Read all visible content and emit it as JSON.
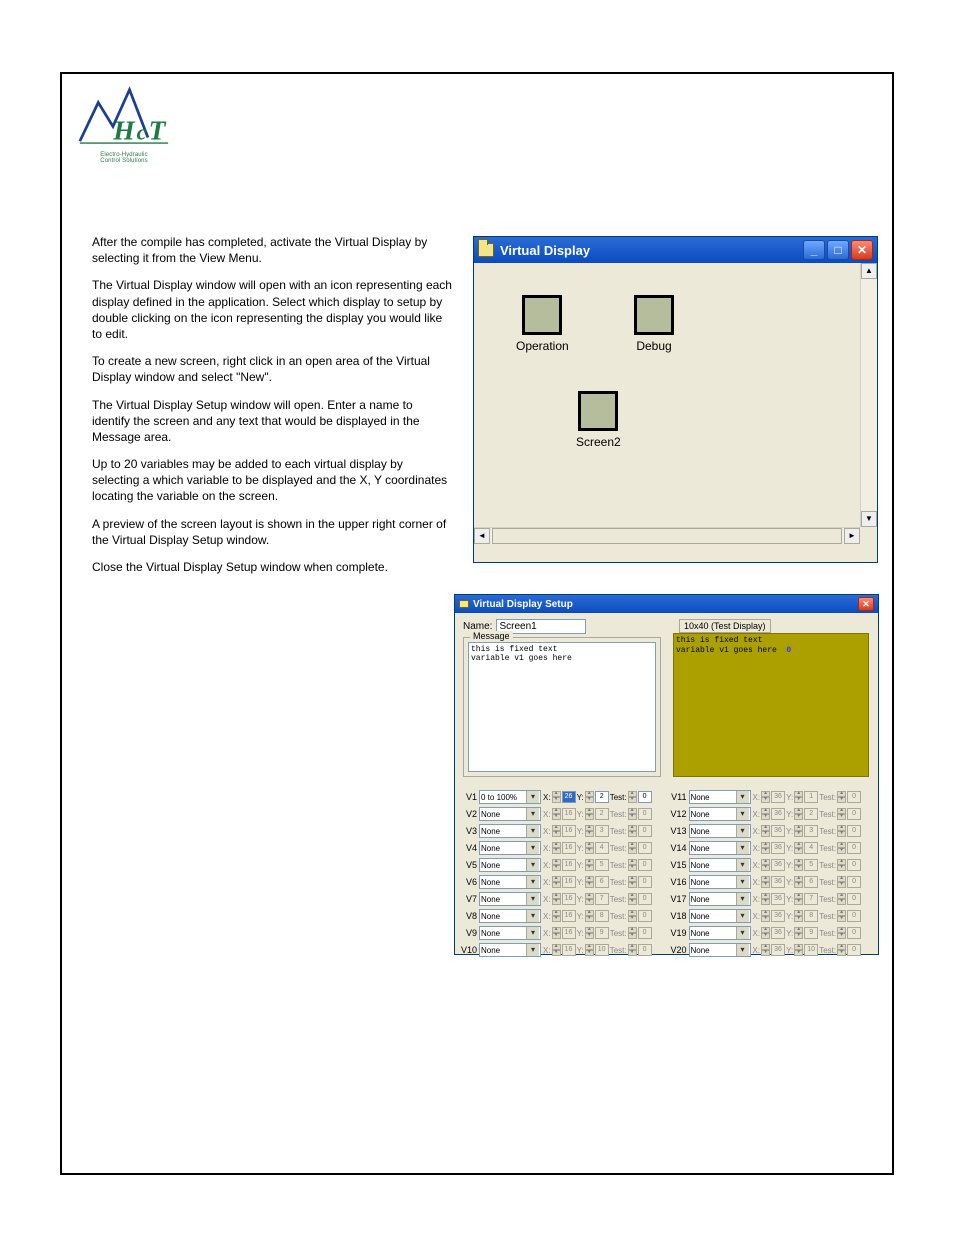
{
  "logo": {
    "line1": "Electro-Hydraulic",
    "line2": "Control Solutions"
  },
  "body_text": {
    "p1": "After the compile has completed, activate the Virtual Display by selecting it from the View Menu.",
    "p2": "The Virtual Display window will open with an icon representing each display defined in the application. Select which display to setup by double clicking on the icon representing the display you would like to edit.",
    "p3": "To create a new screen, right click in an open area of the Virtual Display window and select \"New\".",
    "p4": "The Virtual Display Setup window will open. Enter a name to identify the screen and any text that would be displayed in the Message area.",
    "p5": "Up to 20 variables may be added to each virtual display by selecting a which variable to be displayed and the X, Y coordinates locating the variable on the screen.",
    "p6": "A preview of the screen layout is shown in the upper right corner of the Virtual Display Setup window.",
    "p7": "Close the Virtual Display Setup window when complete."
  },
  "vd": {
    "title": "Virtual Display",
    "screens": {
      "operation": "Operation",
      "debug": "Debug",
      "screen2": "Screen2"
    }
  },
  "vds": {
    "title": "Virtual Display Setup",
    "name_label": "Name:",
    "name_value": "Screen1",
    "message_legend": "Message",
    "message_text": "this is fixed text\nvariable v1 goes here",
    "display_label": "10x40 (Test Display)",
    "preview_text": "this is fixed text\nvariable v1 goes here  ",
    "preview_value": "0",
    "cols": {
      "left": [
        {
          "label": "V1",
          "option": "0 to 100%",
          "x": "26",
          "y": "2",
          "test": "0",
          "active": true,
          "xsel": true
        },
        {
          "label": "V2",
          "option": "None",
          "x": "16",
          "y": "2",
          "test": "0"
        },
        {
          "label": "V3",
          "option": "None",
          "x": "16",
          "y": "3",
          "test": "0"
        },
        {
          "label": "V4",
          "option": "None",
          "x": "16",
          "y": "4",
          "test": "0"
        },
        {
          "label": "V5",
          "option": "None",
          "x": "16",
          "y": "5",
          "test": "0"
        },
        {
          "label": "V6",
          "option": "None",
          "x": "16",
          "y": "6",
          "test": "0"
        },
        {
          "label": "V7",
          "option": "None",
          "x": "16",
          "y": "7",
          "test": "0"
        },
        {
          "label": "V8",
          "option": "None",
          "x": "16",
          "y": "8",
          "test": "0"
        },
        {
          "label": "V9",
          "option": "None",
          "x": "16",
          "y": "9",
          "test": "0"
        },
        {
          "label": "V10",
          "option": "None",
          "x": "16",
          "y": "10",
          "test": "0"
        }
      ],
      "right": [
        {
          "label": "V11",
          "option": "None",
          "x": "36",
          "y": "1",
          "test": "0"
        },
        {
          "label": "V12",
          "option": "None",
          "x": "36",
          "y": "2",
          "test": "0"
        },
        {
          "label": "V13",
          "option": "None",
          "x": "36",
          "y": "3",
          "test": "0"
        },
        {
          "label": "V14",
          "option": "None",
          "x": "36",
          "y": "4",
          "test": "0"
        },
        {
          "label": "V15",
          "option": "None",
          "x": "36",
          "y": "5",
          "test": "0"
        },
        {
          "label": "V16",
          "option": "None",
          "x": "36",
          "y": "6",
          "test": "0"
        },
        {
          "label": "V17",
          "option": "None",
          "x": "36",
          "y": "7",
          "test": "0"
        },
        {
          "label": "V18",
          "option": "None",
          "x": "36",
          "y": "8",
          "test": "0"
        },
        {
          "label": "V19",
          "option": "None",
          "x": "36",
          "y": "9",
          "test": "0"
        },
        {
          "label": "V20",
          "option": "None",
          "x": "36",
          "y": "10",
          "test": "0"
        }
      ]
    }
  },
  "labels": {
    "x": "X:",
    "y": "Y:",
    "test": "Test:"
  }
}
